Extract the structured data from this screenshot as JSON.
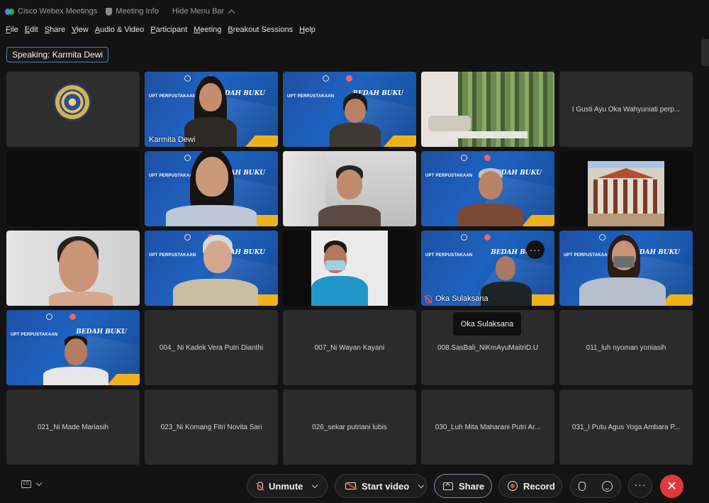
{
  "titlebar": {
    "app_name": "Cisco Webex Meetings",
    "meeting_info": "Meeting Info",
    "hide_menu": "Hide Menu Bar"
  },
  "menu": [
    "File",
    "Edit",
    "Share",
    "View",
    "Audio & Video",
    "Participant",
    "Meeting",
    "Breakout Sessions",
    "Help"
  ],
  "speaking": "Speaking: Karmita Dewi",
  "video_bg": {
    "logo_text": "UPT PERPUSTAKAAN",
    "event_text": "BEDAH BUKU"
  },
  "tiles": {
    "t1_caption": "Karmita Dewi",
    "t4_name": "I Gusti Ayu Oka Wahyuniati perp...",
    "t13_caption": "Oka Sulaksana",
    "t16_name": "004_ Ni Kadek Vera Putri Dianthi",
    "t17_name": "007_Ni Wayan Kayani",
    "t18_name": "008.SasBali_NiKmAyuMaitriD.U",
    "t19_name": "011_luh nyoman yoniasih",
    "t20_name": "021_Ni Made Mariasih",
    "t21_name": "023_Ni Komang Fitri Novita Sari",
    "t22_name": "026_sekar putriani lubis",
    "t23_name": "030_Luh Mita Maharani Putri Ar...",
    "t24_name": "031_I Putu Agus Yoga Ambara P..."
  },
  "tooltip": "Oka Sulaksana",
  "more_dots": "···",
  "toolbar": {
    "unmute": "Unmute",
    "start_video": "Start video",
    "share": "Share",
    "record": "Record",
    "more": "···",
    "end": "✕",
    "captions_icon": "CC"
  },
  "colors": {
    "accent_blue": "#1e62c0",
    "end_red": "#e0393b",
    "banner_yellow": "#f0b21b"
  }
}
